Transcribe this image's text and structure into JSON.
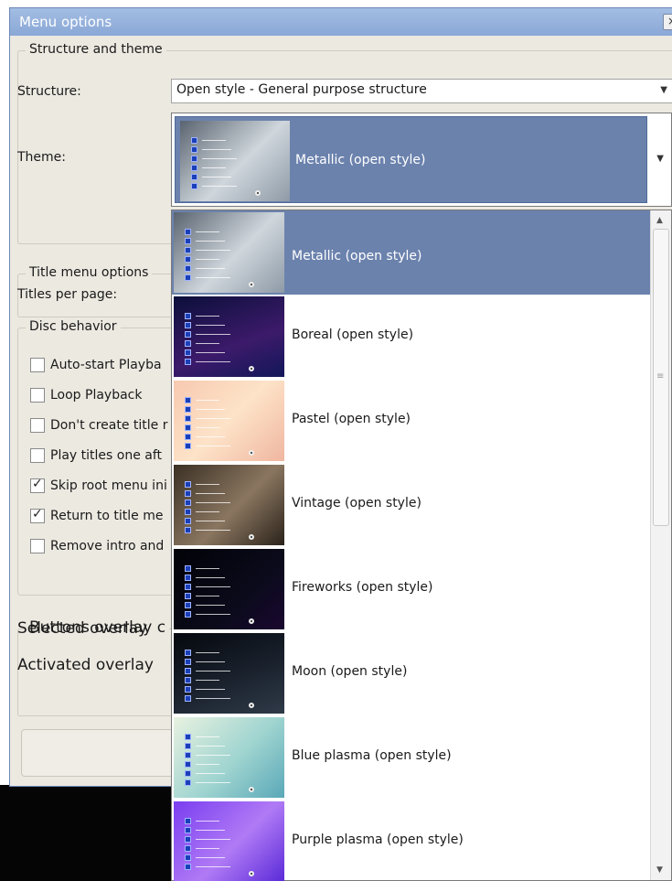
{
  "window": {
    "title": "Menu options",
    "close_glyph": "×"
  },
  "structure_group": {
    "title": "Structure and theme",
    "structure_label": "Structure:",
    "structure_value": "Open style - General purpose structure",
    "theme_label": "Theme:",
    "theme_value": "Metallic (open style)"
  },
  "title_menu_group": {
    "title": "Title menu options",
    "titles_per_page_label": "Titles per page:"
  },
  "disc_group": {
    "title": "Disc behavior",
    "checkboxes": [
      {
        "label": "Auto-start Playba",
        "checked": false
      },
      {
        "label": "Loop Playback",
        "checked": false
      },
      {
        "label": "Don't create title r",
        "checked": false
      },
      {
        "label": "Play titles one aft",
        "checked": false
      },
      {
        "label": "Skip root menu ini",
        "checked": true
      },
      {
        "label": "Return to title me",
        "checked": true
      },
      {
        "label": "Remove intro and",
        "checked": false
      }
    ]
  },
  "overlay_group": {
    "title": "Buttons overlay c",
    "selected_label": "Selected overlay",
    "activated_label": "Activated overlay"
  },
  "theme_list": [
    {
      "label": "Metallic (open style)",
      "selected": true,
      "bg": "linear-gradient(135deg,#5a6470,#cfd6dc 55%,#8e9aa6)"
    },
    {
      "label": "Boreal (open style)",
      "selected": false,
      "bg": "linear-gradient(160deg,#0b0f3a,#3c1a6b 60%,#12175a)"
    },
    {
      "label": "Pastel (open style)",
      "selected": false,
      "bg": "linear-gradient(135deg,#f7c9b0,#fde3c8 50%,#f0b6a0)"
    },
    {
      "label": "Vintage (open style)",
      "selected": false,
      "bg": "linear-gradient(135deg,#3a3024,#8a7660 55%,#2a221a)"
    },
    {
      "label": "Fireworks (open style)",
      "selected": false,
      "bg": "linear-gradient(135deg,#020208,#0a0a1a 60%,#1a0830)"
    },
    {
      "label": "Moon (open style)",
      "selected": false,
      "bg": "linear-gradient(160deg,#05080e,#1c2430 60%,#2f3a48)"
    },
    {
      "label": "Blue plasma (open style)",
      "selected": false,
      "bg": "linear-gradient(135deg,#e8f2e0,#9fd4d0 55%,#5aa8b8)"
    },
    {
      "label": "Purple plasma (open style)",
      "selected": false,
      "bg": "linear-gradient(135deg,#7a3ef0,#b07af5 55%,#5a2ad8)"
    }
  ],
  "colors": {
    "selection": "#6b82ad",
    "window_bg": "#ece9e1",
    "titlebar": "#98b3de"
  },
  "icons": {
    "combo_arrow": "chevron-down-icon",
    "scroll_up": "scroll-up-icon",
    "scroll_down": "scroll-down-icon"
  }
}
